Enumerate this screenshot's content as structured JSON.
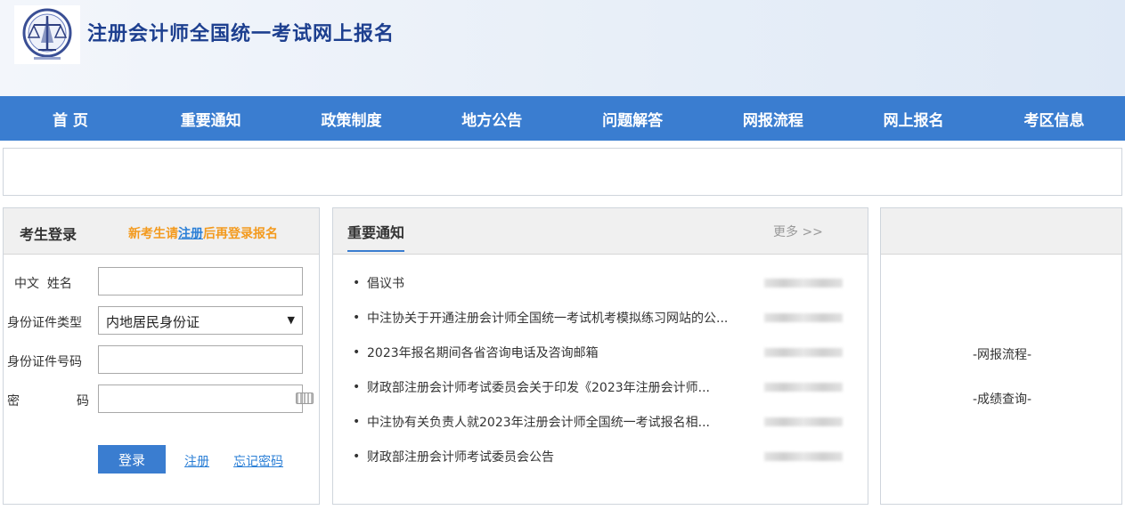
{
  "header": {
    "site_title": "注册会计师全国统一考试网上报名"
  },
  "nav": {
    "items": [
      {
        "label": "首 页"
      },
      {
        "label": "重要通知"
      },
      {
        "label": "政策制度"
      },
      {
        "label": "地方公告"
      },
      {
        "label": "问题解答"
      },
      {
        "label": "网报流程"
      },
      {
        "label": "网上报名"
      },
      {
        "label": "考区信息"
      }
    ]
  },
  "login": {
    "title": "考生登录",
    "hint_prefix": "新考生请",
    "hint_link": "注册",
    "hint_suffix": "后再登录报名",
    "name_label_part1": "中文",
    "name_label_part2": "姓名",
    "name_value": "",
    "id_type_label": "身份证件类型",
    "id_type_value": "内地居民身份证",
    "id_number_label": "身份证件号码",
    "id_number_value": "",
    "password_label_part1": "密",
    "password_label_part2": "码",
    "password_value": "",
    "login_button": "登录",
    "register_link": "注册",
    "forgot_link": "忘记密码"
  },
  "notices": {
    "title": "重要通知",
    "more": "更多 >>",
    "items": [
      {
        "text": "倡议书",
        "date": "2023-03-07"
      },
      {
        "text": "中注协关于开通注册会计师全国统一考试机考模拟练习网站的公...",
        "date": "2023-03-04"
      },
      {
        "text": "2023年报名期间各省咨询电话及咨询邮箱",
        "date": "2023-03-06"
      },
      {
        "text": "财政部注册会计师考试委员会关于印发《2023年注册会计师...",
        "date": "2023-03-03"
      },
      {
        "text": "中注协有关负责人就2023年注册会计师全国统一考试报名相...",
        "date": "2023-03-03"
      },
      {
        "text": "财政部注册会计师考试委员会公告",
        "date": "2023-03-03"
      }
    ]
  },
  "side": {
    "link1": "-网报流程-",
    "link2": "-成绩查询-"
  },
  "colors": {
    "nav_bg": "#3a7dd0",
    "title_blue": "#1d3f8f",
    "hint_orange": "#f39a1e",
    "link_blue": "#2b7fd6"
  }
}
